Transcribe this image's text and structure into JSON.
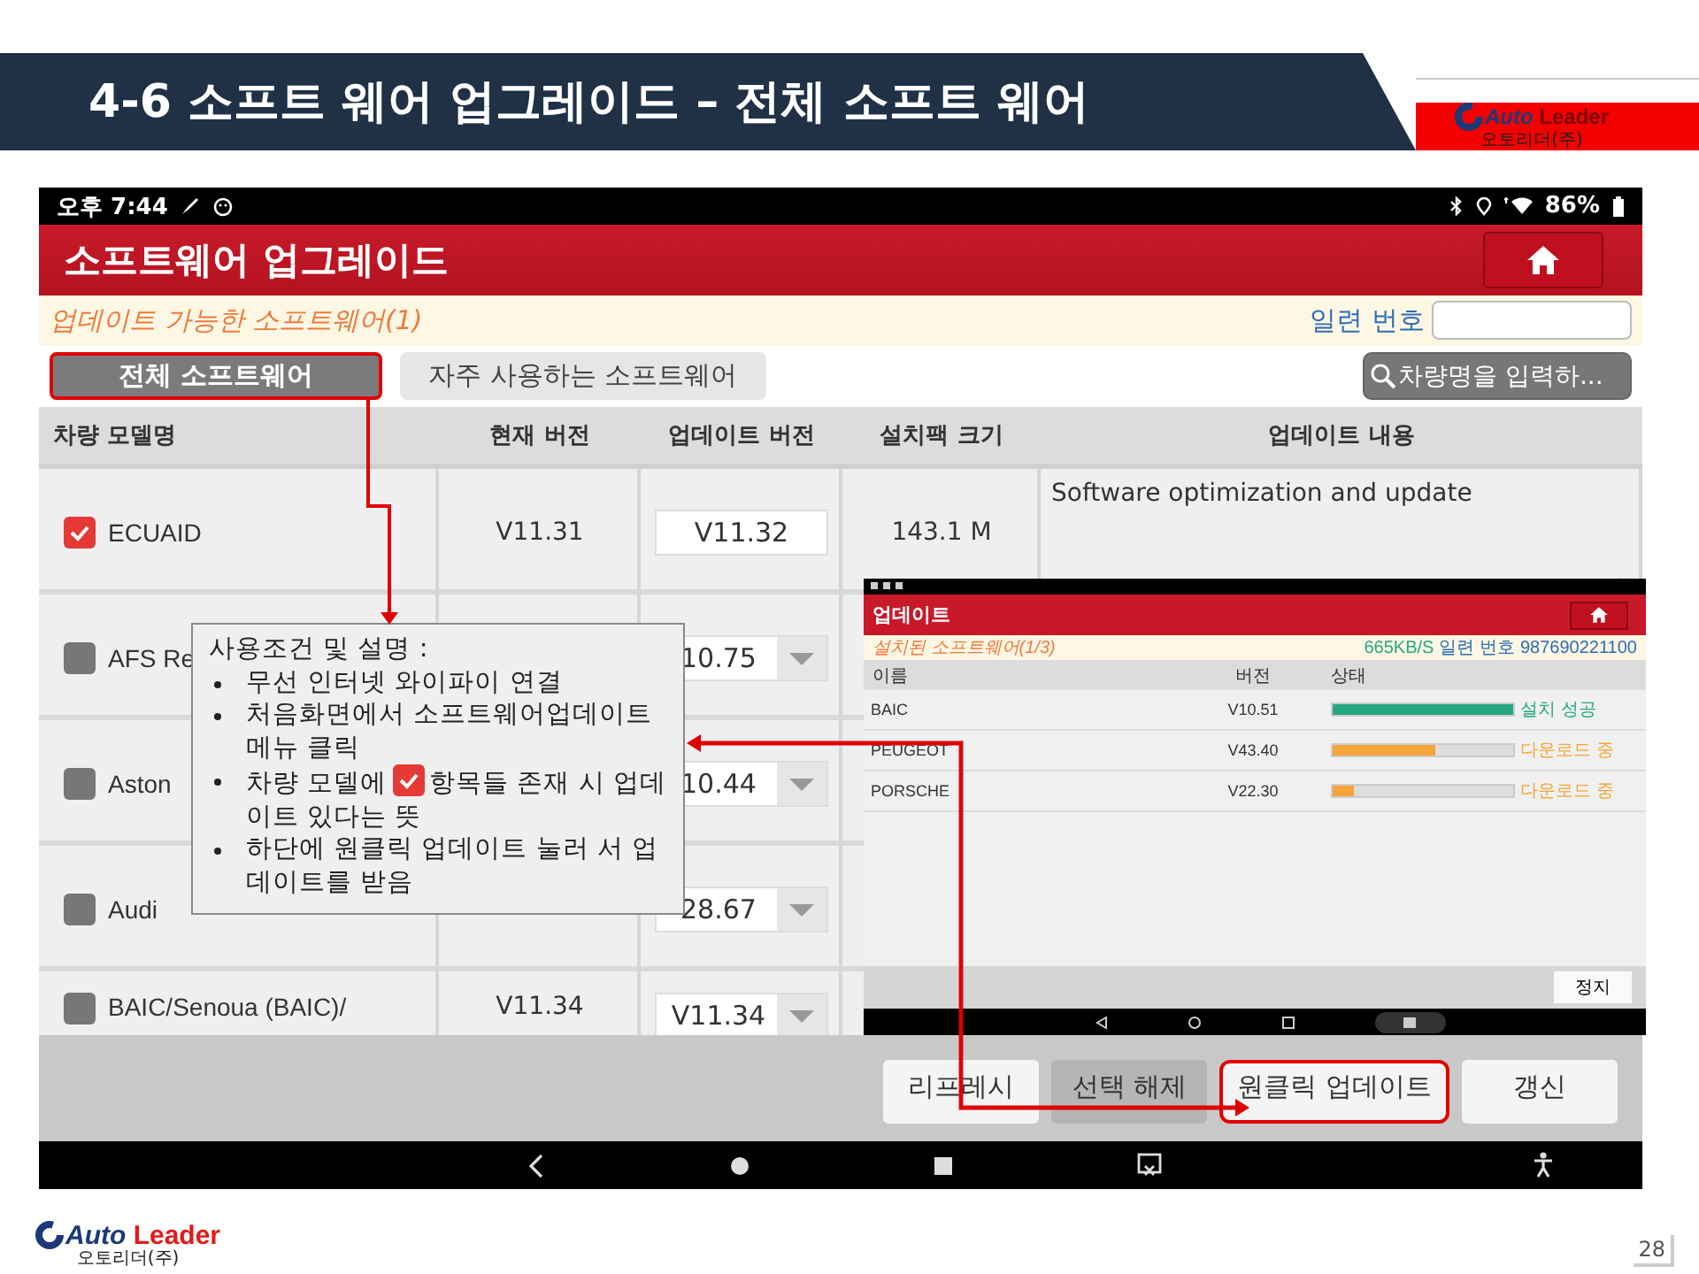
{
  "slide": {
    "title": "4-6 소프트 웨어 업그레이드 – 전체 소프트 웨어",
    "page_number": "28"
  },
  "logos": [
    {
      "brand_first": "Auto",
      "brand_second": "Leader",
      "company": "오토리더(주)"
    },
    {
      "brand_first": "Auto",
      "brand_second": "Leader",
      "company": "오토리더(주)"
    }
  ],
  "app": {
    "status_bar": {
      "time": "오후 7:44",
      "battery": "86%"
    },
    "title": "소프트웨어 업그레이드",
    "info_bar": {
      "available": "업데이트 가능한 소프트웨어(1)",
      "serial_label": "일련 번호"
    },
    "tabs": [
      {
        "label": "전체 소프트웨어",
        "selected": true,
        "highlighted": true
      },
      {
        "label": "자주 사용하는 소프트웨어",
        "selected": false,
        "highlighted": false
      }
    ],
    "search": {
      "placeholder": "차량명을 입력하..."
    },
    "table": {
      "columns": [
        "차량 모델명",
        "현재 버전",
        "업데이트 버전",
        "설치팩 크기",
        "업데이트 내용"
      ],
      "rows": [
        {
          "name": "ECUAID",
          "checked": true,
          "current": "V11.31",
          "update": "V11.32",
          "kind": "fixed",
          "size": "143.1 M",
          "content": "Software optimization and update"
        },
        {
          "name": "AFS Re",
          "checked": false,
          "update": "10.75",
          "kind": "dropdown"
        },
        {
          "name": "Aston",
          "checked": false,
          "update": "10.44",
          "kind": "dropdown"
        },
        {
          "name": "Audi",
          "checked": false,
          "update": "28.67",
          "kind": "dropdown"
        },
        {
          "name": "BAIC/Senoua (BAIC)/",
          "checked": false,
          "current": "V11.34",
          "update": "V11.34",
          "kind": "dropdown"
        }
      ]
    },
    "buttons": [
      {
        "label": "리프레시",
        "disabled": false,
        "highlighted": false
      },
      {
        "label": "선택 해제",
        "disabled": true,
        "highlighted": false
      },
      {
        "label": "원클릭 업데이트",
        "disabled": false,
        "highlighted": true
      },
      {
        "label": "갱신",
        "disabled": false,
        "highlighted": false
      }
    ]
  },
  "callout": {
    "title": "사용조건 및 설명 :",
    "bullets": [
      {
        "kind": "plain",
        "text": "무선 인터넷 와이파이 연결"
      },
      {
        "kind": "plain",
        "text": "처음화면에서 소프트웨어업데이트 메뉴 클릭"
      },
      {
        "kind": "with_checkbox",
        "text": "차량 모델에",
        "text_after": "항목들 존재 시 업데이트 있다는 뜻"
      },
      {
        "kind": "plain",
        "text": "하단에 원클릭 업데이트 눌러 서 업데이트를 받음"
      }
    ]
  },
  "inset": {
    "title": "업데이트",
    "installed": "설치된 소프트웨어(1/3)",
    "speed": "665KB/S",
    "serial_label": "일련 번호",
    "serial": "987690221100",
    "columns": [
      "이름",
      "버전",
      "상태"
    ],
    "rows": [
      {
        "name": "BAIC",
        "version": "V10.51",
        "level": 1,
        "color": "#26a882",
        "status": "설치 성공"
      },
      {
        "name": "PEUGEOT",
        "version": "V43.40",
        "level": 0.57,
        "color": "#f5a53a",
        "status": "다운로드 중"
      },
      {
        "name": "PORSCHE",
        "version": "V22.30",
        "level": 0.12,
        "color": "#f5a53a",
        "status": "다운로드 중"
      }
    ],
    "stop_button": "정지"
  }
}
